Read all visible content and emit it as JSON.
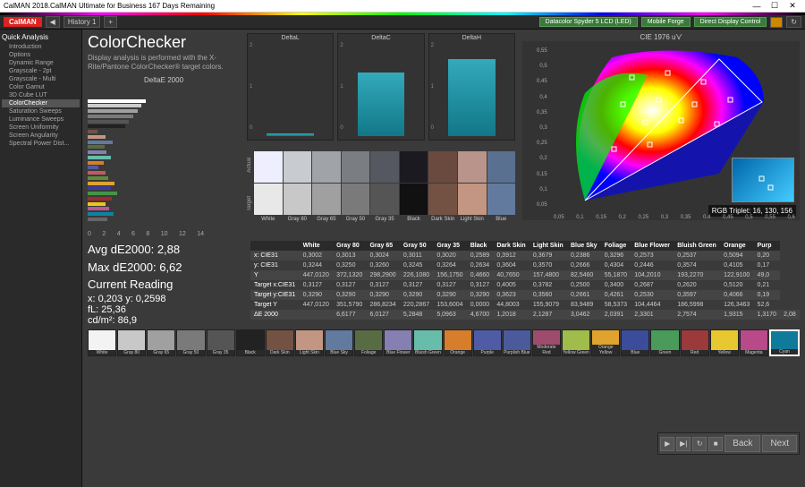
{
  "window": {
    "title": "CalMAN 2018.CalMAN Ultimate for Business 167 Days Remaining"
  },
  "brand": "CalMAN",
  "history_tab": "History 1",
  "top_buttons": {
    "detector": "Datacolor Spyder 5\nLCD (LED)",
    "forge": "Mobile Forge",
    "display": "Direct Display Control"
  },
  "sidebar": {
    "header": "Quick Analysis",
    "items": [
      "Introduction",
      "Options",
      "Dynamic Range",
      "Grayscale - 2pt",
      "Grayscale - Multi",
      "Color Gamut",
      "3D Cube LUT",
      "ColorChecker",
      "Saturation Sweeps",
      "Luminance Sweeps",
      "Screen Uniformity",
      "Screen Angularity",
      "Spectral Power Dist..."
    ],
    "selected": 7
  },
  "page_title": "ColorChecker",
  "subtitle": "Display analysis is performed with the X-Rite/Pantone ColorChecker® target colors.",
  "deltae_chart": {
    "title": "DeltaE 2000",
    "xticks": [
      "0",
      "2",
      "4",
      "6",
      "8",
      "10",
      "12",
      "14"
    ]
  },
  "triple_titles": [
    "DeltaL",
    "DeltaC",
    "DeltaH"
  ],
  "swatch_side": [
    "Actual",
    "Target"
  ],
  "swatch_labels": [
    "White",
    "Gray 80",
    "Gray 65",
    "Gray 50",
    "Gray 35",
    "Black",
    "Dark Skin",
    "Light Skin",
    "Blue"
  ],
  "cie": {
    "title": "CIE 1976 u'v'",
    "rgb": "RGB Triplet: 16, 130, 156",
    "xticks": [
      "0,05",
      "0,1",
      "0,15",
      "0,2",
      "0,25",
      "0,3",
      "0,35",
      "0,4",
      "0,45",
      "0,5",
      "0,55",
      "0,6"
    ],
    "yticks": [
      "0,55",
      "0,5",
      "0,45",
      "0,4",
      "0,35",
      "0,3",
      "0,25",
      "0,2",
      "0,15",
      "0,1",
      "0,05"
    ]
  },
  "stats": {
    "avg": "Avg dE2000: 2,88",
    "max": "Max dE2000: 6,62",
    "cur": "Current Reading",
    "xy": "x: 0,203    y: 0,2598",
    "fl": "fL: 25,36",
    "cd": "cd/m²: 86,9"
  },
  "table": {
    "cols": [
      "",
      "White",
      "Gray 80",
      "Gray 65",
      "Gray 50",
      "Gray 35",
      "Black",
      "Dark Skin",
      "Light Skin",
      "Blue Sky",
      "Foliage",
      "Blue Flower",
      "Bluish Green",
      "Orange",
      "Purp"
    ],
    "rows": [
      [
        "x: CIE31",
        "0,3002",
        "0,3013",
        "0,3024",
        "0,3011",
        "0,3020",
        "0,2589",
        "0,3912",
        "0,3679",
        "0,2386",
        "0,3296",
        "0,2573",
        "0,2537",
        "0,5094",
        "0,20"
      ],
      [
        "y: CIE31",
        "0,3244",
        "0,3250",
        "0,3260",
        "0,3245",
        "0,3264",
        "0,2634",
        "0,3604",
        "0,3570",
        "0,2666",
        "0,4304",
        "0,2446",
        "0,3574",
        "0,4105",
        "0,17"
      ],
      [
        "Y",
        "447,0120",
        "372,1320",
        "298,2900",
        "226,1080",
        "156,1750",
        "0,4660",
        "40,7650",
        "157,4800",
        "82,5460",
        "55,1870",
        "104,2010",
        "193,2270",
        "122,9100",
        "49,0"
      ],
      [
        "Target x:CIE31",
        "0,3127",
        "0,3127",
        "0,3127",
        "0,3127",
        "0,3127",
        "0,3127",
        "0,4005",
        "0,3782",
        "0,2500",
        "0,3400",
        "0,2687",
        "0,2620",
        "0,5120",
        "0,21"
      ],
      [
        "Target y:CIE31",
        "0,3290",
        "0,3290",
        "0,3290",
        "0,3290",
        "0,3290",
        "0,3290",
        "0,3623",
        "0,3560",
        "0,2661",
        "0,4261",
        "0,2530",
        "0,3597",
        "0,4066",
        "0,19"
      ],
      [
        "Target Y",
        "447,0120",
        "351,5790",
        "286,8234",
        "220,2867",
        "153,6004",
        "0,0000",
        "44,8003",
        "155,9079",
        "83,9489",
        "58,5373",
        "104,4464",
        "186,5998",
        "126,3463",
        "52,6"
      ],
      [
        "ΔE 2000",
        "",
        "6,6177",
        "6,0127",
        "5,2848",
        "5,0963",
        "4,6700",
        "1,2018",
        "2,1287",
        "3,0462",
        "2,0391",
        "2,3301",
        "2,7574",
        "1,9315",
        "1,3170",
        "2,08"
      ]
    ]
  },
  "bottom": [
    "White",
    "Gray 80",
    "Gray 65",
    "Gray 50",
    "Gray 35",
    "Black",
    "Dark Skin",
    "Light Skin",
    "Blue Sky",
    "Foliage",
    "Blue Flower",
    "Bluish Green",
    "Orange",
    "Purple",
    "Purplish Blue",
    "Moderate Red",
    "Yellow Green",
    "Orange Yellow",
    "Blue",
    "Green",
    "Red",
    "Yellow",
    "Magenta",
    "Cyan"
  ],
  "bottom_colors": [
    "#f3f3f3",
    "#c8c8c8",
    "#a0a0a0",
    "#7a7a7a",
    "#555",
    "#222",
    "#735244",
    "#c29682",
    "#627a9d",
    "#576c43",
    "#8580b1",
    "#67bdaa",
    "#d67e2c",
    "#505ba6",
    "#4a5a9a",
    "#9e4c6e",
    "#a0bc4a",
    "#e0a32e",
    "#3a4c9a",
    "#4a9a5a",
    "#9a3a3a",
    "#e8c830",
    "#b84a8a",
    "#107a9a"
  ],
  "nav": {
    "back": "Back",
    "next": "Next"
  },
  "chart_data": {
    "triple": [
      {
        "name": "DeltaL",
        "type": "bar",
        "value": 0.05,
        "ylim": [
          0,
          2
        ]
      },
      {
        "name": "DeltaC",
        "type": "bar",
        "value": 1.4,
        "ylim": [
          0,
          2
        ]
      },
      {
        "name": "DeltaH",
        "type": "bar",
        "value": 1.7,
        "ylim": [
          0,
          2
        ]
      }
    ],
    "deltae2000": {
      "type": "bar",
      "orientation": "h",
      "xlim": [
        0,
        14
      ]
    }
  }
}
